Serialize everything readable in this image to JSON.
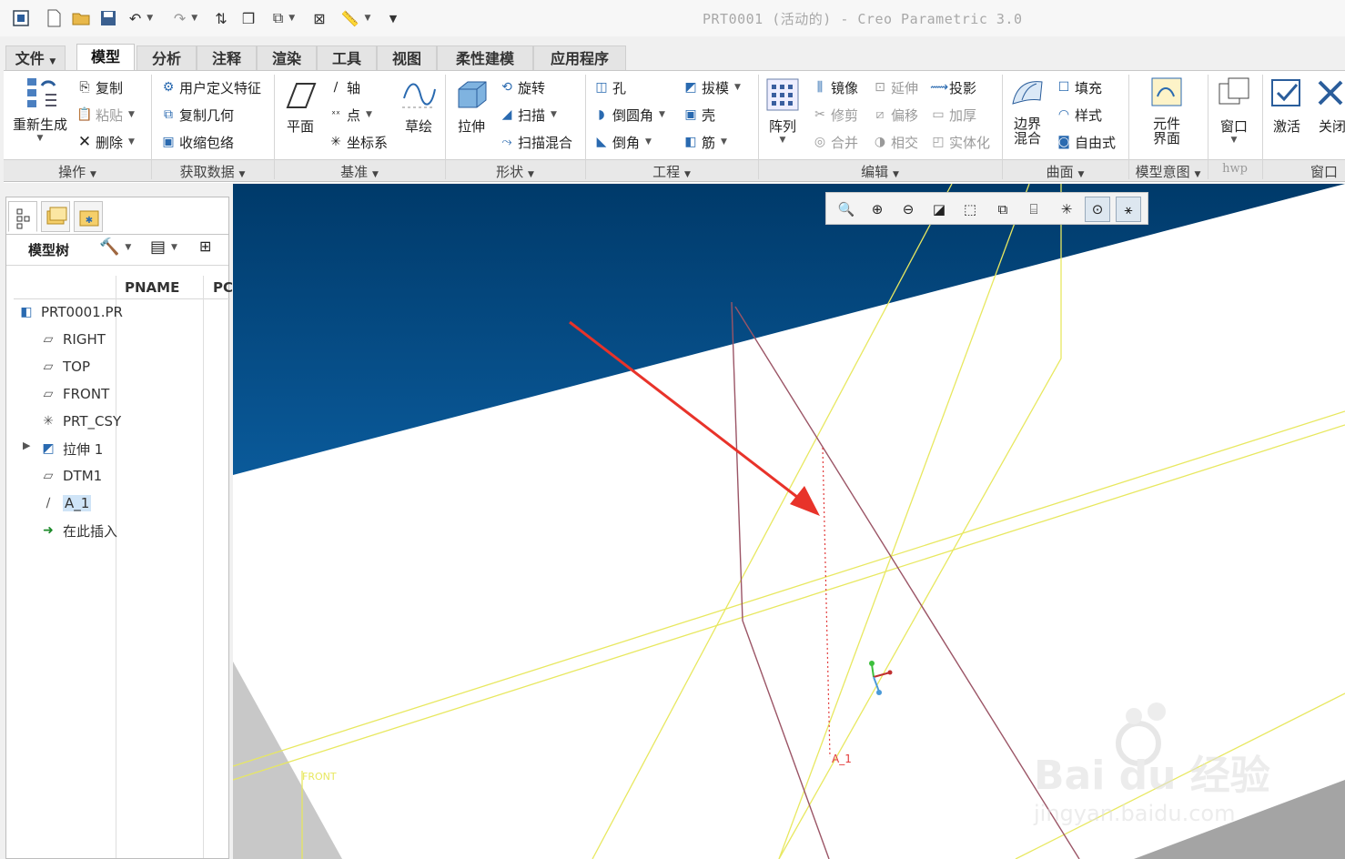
{
  "window": {
    "title": "PRT0001 (活动的) - Creo Parametric 3.0"
  },
  "quick_access": [
    "app-icon",
    "new-icon",
    "open-icon",
    "save-icon",
    "undo-icon",
    "redo-icon",
    "regenerate-icon",
    "windows-icon",
    "close-window-icon",
    "measure-icon",
    "customize-icon"
  ],
  "tabs": [
    "文件",
    "模型",
    "分析",
    "注释",
    "渲染",
    "工具",
    "视图",
    "柔性建模",
    "应用程序"
  ],
  "active_tab": "模型",
  "ribbon": {
    "operations": {
      "regenerate": "重新生成",
      "copy": "复制",
      "paste": "粘贴",
      "delete": "删除",
      "label": "操作"
    },
    "get_data": {
      "udf": "用户定义特征",
      "copy_geom": "复制几何",
      "shrinkwrap": "收缩包络",
      "label": "获取数据"
    },
    "datum": {
      "plane": "平面",
      "axis": "轴",
      "point": "点",
      "csys": "坐标系",
      "sketch": "草绘",
      "label": "基准"
    },
    "shapes": {
      "extrude": "拉伸",
      "revolve": "旋转",
      "sweep": "扫描",
      "swept_blend": "扫描混合",
      "label": "形状"
    },
    "engineering": {
      "hole": "孔",
      "draft": "拔模",
      "round": "倒圆角",
      "shell": "壳",
      "chamfer": "倒角",
      "rib": "筋",
      "label": "工程"
    },
    "editing": {
      "pattern": "阵列",
      "mirror": "镜像",
      "extend": "延伸",
      "project": "投影",
      "trim": "修剪",
      "offset": "偏移",
      "thicken": "加厚",
      "merge": "合并",
      "intersect": "相交",
      "solidify": "实体化",
      "label": "编辑"
    },
    "surfaces": {
      "boundary_blend": "边界混合",
      "fill": "填充",
      "style": "样式",
      "freestyle": "自由式",
      "label": "曲面"
    },
    "model_intent": {
      "component_interface": "元件界面",
      "label": "模型意图"
    },
    "hwp": {
      "window": "窗口",
      "label": "hwp"
    },
    "window": {
      "activate": "激活",
      "close": "关闭",
      "label": "窗口"
    }
  },
  "left_panel": {
    "title": "模型树",
    "columns": [
      "PNAME",
      "PC"
    ],
    "items": [
      {
        "label": "PRT0001.PR",
        "icon": "part-icon"
      },
      {
        "label": "RIGHT",
        "icon": "datum-plane-icon"
      },
      {
        "label": "TOP",
        "icon": "datum-plane-icon"
      },
      {
        "label": "FRONT",
        "icon": "datum-plane-icon"
      },
      {
        "label": "PRT_CSY",
        "icon": "csys-icon"
      },
      {
        "label": "拉伸 1",
        "icon": "extrude-icon"
      },
      {
        "label": "DTM1",
        "icon": "datum-plane-icon"
      },
      {
        "label": "A_1",
        "icon": "datum-axis-icon",
        "selected": true
      },
      {
        "label": "在此插入",
        "icon": "insert-here-icon"
      }
    ]
  },
  "viewport": {
    "axis_label": "A_1",
    "plane_label": "FRONT",
    "watermark_brand": "Bai du 经验",
    "watermark_url": "jingyan.baidu.com"
  },
  "colors": {
    "accent": "#1e5fa0",
    "sky_top": "#003a6a",
    "datum": "#e8e860",
    "edge": "#9b5566",
    "arrow": "#e8332a"
  }
}
